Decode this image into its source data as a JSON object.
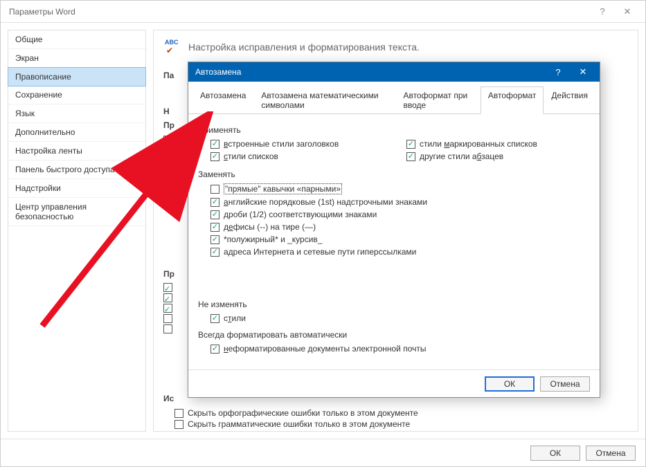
{
  "window": {
    "title": "Параметры Word",
    "help": "?",
    "close": "✕"
  },
  "sidebar": {
    "items": [
      {
        "label": "Общие"
      },
      {
        "label": "Экран"
      },
      {
        "label": "Правописание"
      },
      {
        "label": "Сохранение"
      },
      {
        "label": "Язык"
      },
      {
        "label": "Дополнительно"
      },
      {
        "label": "Настройка ленты"
      },
      {
        "label": "Панель быстрого доступа"
      },
      {
        "label": "Надстройки"
      },
      {
        "label": "Центр управления безопасностью"
      }
    ],
    "selected_index": 2
  },
  "main": {
    "header": "Настройка исправления и форматирования текста.",
    "bg_labels": {
      "pa": "Па",
      "n": "Н",
      "pr": "Пр",
      "pr2": "Пр",
      "is": "Ис"
    },
    "bottom_checks": [
      {
        "checked": false,
        "label": "Скрыть орфографические ошибки только в этом документе"
      },
      {
        "checked": false,
        "label": "Скрыть грамматические ошибки только в этом документе"
      }
    ]
  },
  "dialog": {
    "title": "Автозамена",
    "help": "?",
    "close": "✕",
    "tabs": [
      "Автозамена",
      "Автозамена математическими символами",
      "Автоформат при вводе",
      "Автоформат",
      "Действия"
    ],
    "active_tab_index": 3,
    "groups": {
      "apply": {
        "label": "Применять",
        "left": [
          {
            "checked": true,
            "label_pre": "",
            "u": "в",
            "label_post": "строенные стили заголовков"
          },
          {
            "checked": true,
            "label_pre": "",
            "u": "с",
            "label_post": "тили списков"
          }
        ],
        "right": [
          {
            "checked": true,
            "label_pre": "стили ",
            "u": "м",
            "label_post": "аркированных списков"
          },
          {
            "checked": true,
            "label_pre": "другие стили а",
            "u": "б",
            "label_post": "зацев"
          }
        ]
      },
      "replace": {
        "label": "Заменять",
        "items": [
          {
            "checked": false,
            "focus": true,
            "label": "\"прямые\" кавычки «парными»"
          },
          {
            "checked": true,
            "label_pre": "",
            "u": "а",
            "label_post": "нглийские порядковые (1st) надстрочными знаками"
          },
          {
            "checked": true,
            "label_pre": "",
            "u": "д",
            "label_post": "роби (1/2) соответствующими знаками"
          },
          {
            "checked": true,
            "label_pre": "д",
            "u": "е",
            "label_post": "фисы (--) на тире (—)"
          },
          {
            "checked": true,
            "label": "*полужирный* и _курсив_"
          },
          {
            "checked": true,
            "label": "адреса Интернета и сетевые пути гиперссылками"
          }
        ]
      },
      "preserve": {
        "label": "Не изменять",
        "items": [
          {
            "checked": true,
            "label_pre": "с",
            "u": "т",
            "label_post": "или"
          }
        ]
      },
      "always": {
        "label": "Всегда форматировать автоматически",
        "items": [
          {
            "checked": true,
            "label_pre": "",
            "u": "н",
            "label_post": "еформатированные документы электронной почты"
          }
        ]
      }
    },
    "buttons": {
      "ok": "ОК",
      "cancel": "Отмена"
    }
  },
  "footer": {
    "ok": "ОК",
    "cancel": "Отмена"
  }
}
